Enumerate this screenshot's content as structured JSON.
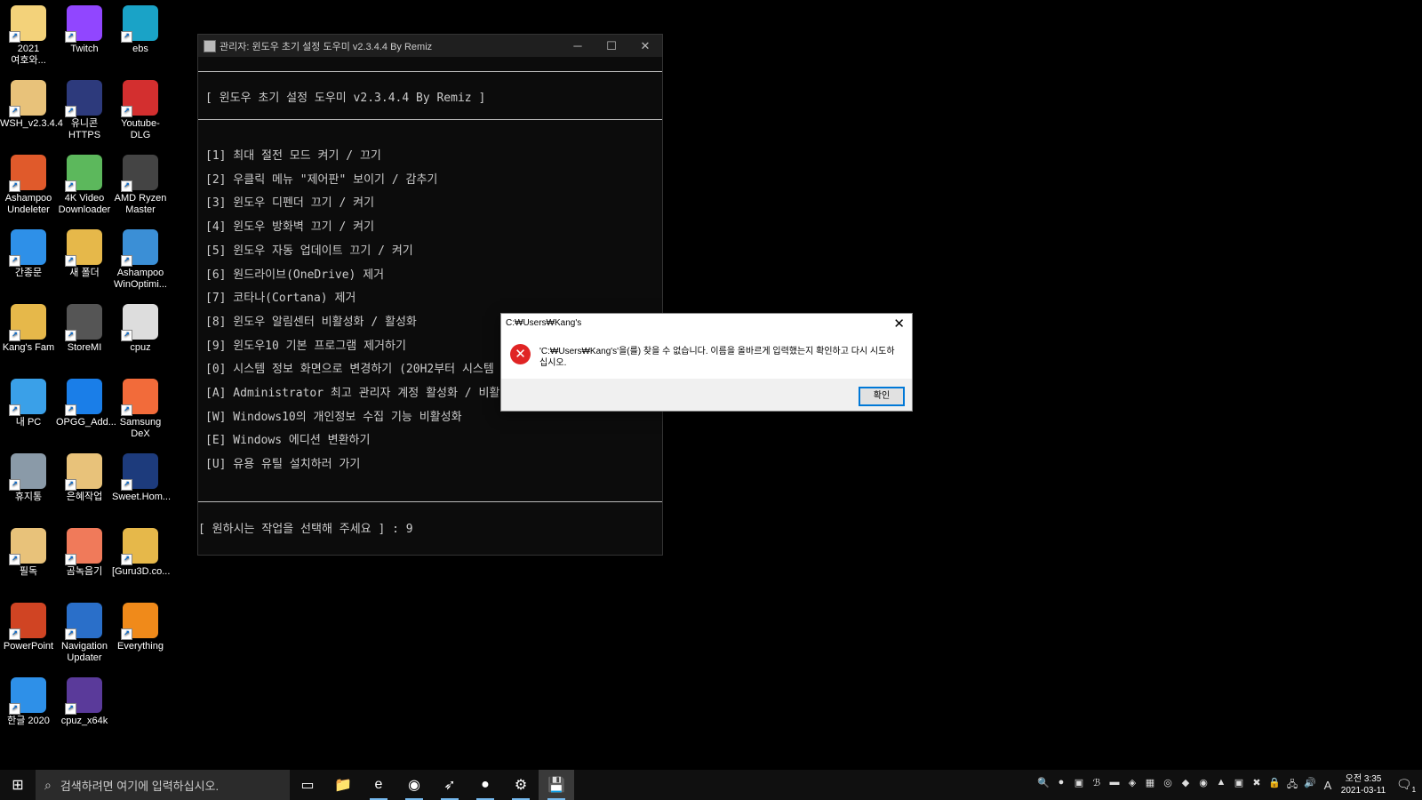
{
  "desktop": {
    "icons": [
      {
        "label": "2021\n여호와...",
        "icon": "folder-icon",
        "color": "#f3d27a"
      },
      {
        "label": "Twitch",
        "icon": "twitch-icon",
        "color": "#9146ff"
      },
      {
        "label": "ebs",
        "icon": "ebs-icon",
        "color": "#1aa3c7"
      },
      {
        "label": "WSH_v2.3.4.4",
        "icon": "archive-icon",
        "color": "#e8c27a"
      },
      {
        "label": "유니콘\nHTTPS",
        "icon": "unicorn-icon",
        "color": "#2d3a7c"
      },
      {
        "label": "Youtube-DLG",
        "icon": "download-icon",
        "color": "#d32f2f"
      },
      {
        "label": "Ashampoo\nUndeleter",
        "icon": "undeleter-icon",
        "color": "#e05a2b"
      },
      {
        "label": "4K Video\nDownloader",
        "icon": "cloud-download-icon",
        "color": "#5cb85c"
      },
      {
        "label": "AMD Ryzen\nMaster",
        "icon": "ryzen-icon",
        "color": "#444444"
      },
      {
        "label": "간종문",
        "icon": "hangul-doc-icon",
        "color": "#2e90e8"
      },
      {
        "label": "새 폴더",
        "icon": "folder-icon",
        "color": "#e6b84a"
      },
      {
        "label": "Ashampoo\nWinOptimi...",
        "icon": "winoptimizer-icon",
        "color": "#3b8fd6"
      },
      {
        "label": "Kang's Fam",
        "icon": "user-folder-icon",
        "color": "#e6b84a"
      },
      {
        "label": "StoreMI",
        "icon": "storemi-icon",
        "color": "#555555"
      },
      {
        "label": "cpuz",
        "icon": "file-gear-icon",
        "color": "#dddddd"
      },
      {
        "label": "내 PC",
        "icon": "pc-icon",
        "color": "#3aa0e8"
      },
      {
        "label": "OPGG_Add...",
        "icon": "opgg-icon",
        "color": "#1a7ee8"
      },
      {
        "label": "Samsung\nDeX",
        "icon": "dex-icon",
        "color": "#f26b3a"
      },
      {
        "label": "휴지통",
        "icon": "recycle-bin-icon",
        "color": "#8a9aa8"
      },
      {
        "label": "은혜작업",
        "icon": "archive-icon",
        "color": "#e8c27a"
      },
      {
        "label": "Sweet.Hom...",
        "icon": "book-icon",
        "color": "#1d3b7c"
      },
      {
        "label": "필독",
        "icon": "archive-icon",
        "color": "#e8c27a"
      },
      {
        "label": "곰녹음기",
        "icon": "mic-icon",
        "color": "#f07a5a"
      },
      {
        "label": "[Guru3D.co...",
        "icon": "folder-icon",
        "color": "#e6b84a"
      },
      {
        "label": "PowerPoint",
        "icon": "powerpoint-icon",
        "color": "#d04423"
      },
      {
        "label": "Navigation\nUpdater",
        "icon": "navigation-icon",
        "color": "#2a6fc9"
      },
      {
        "label": "Everything",
        "icon": "magnifier-icon",
        "color": "#f08a1a"
      },
      {
        "label": "한글 2020",
        "icon": "hangul-icon",
        "color": "#2e90e8"
      },
      {
        "label": "cpuz_x64k",
        "icon": "chip-icon",
        "color": "#5a3a9a"
      }
    ]
  },
  "console": {
    "title": "관리자:  윈도우 초기 설정 도우미 v2.3.4.4 By Remiz",
    "header": "[ 윈도우 초기 설정 도우미 v2.3.4.4 By Remiz ]",
    "menu": [
      "[1] 최대 절전 모드 켜기 / 끄기",
      "[2] 우클릭 메뉴 \"제어판\" 보이기 / 감추기",
      "[3] 윈도우 디펜더 끄기 / 켜기",
      "[4] 윈도우 방화벽 끄기 / 켜기",
      "[5] 윈도우 자동 업데이트 끄기 / 켜기",
      "[6] 원드라이브(OneDrive) 제거",
      "[7] 코타나(Cortana) 제거",
      "[8] 윈도우 알림센터 비활성화 / 활성화",
      "[9] 윈도우10 기본 프로그램 제거하기",
      "[0] 시스템 정보 화면으로 변경하기 (20H2부터 시스템",
      "[A] Administrator 최고 관리자 계정 활성화 / 비활성",
      "[W] Windows10의 개인정보 수집 기능 비활성화",
      "[E] Windows 에디션 변환하기",
      "[U] 유용 유틸 설치하러 가기"
    ],
    "prompt": "[ 원하시는 작업을 선택해 주세요 ] : 9"
  },
  "dialog": {
    "title": "C:₩Users₩Kang's",
    "message": "'C:₩Users₩Kang's'을(를) 찾을 수 없습니다. 이름을 올바르게 입력했는지 확인하고 다시 시도하십시오.",
    "ok_label": "확인"
  },
  "taskbar": {
    "search_placeholder": "검색하려면 여기에 입력하십시오.",
    "apps": [
      {
        "name": "task-view-icon",
        "glyph": "▭"
      },
      {
        "name": "file-explorer-icon",
        "glyph": "📁"
      },
      {
        "name": "edge-icon",
        "glyph": "e"
      },
      {
        "name": "chrome-icon",
        "glyph": "◉"
      },
      {
        "name": "bird-app-icon",
        "glyph": "➶"
      },
      {
        "name": "kakaotalk-icon",
        "glyph": "●"
      },
      {
        "name": "settings-icon",
        "glyph": "⚙"
      },
      {
        "name": "console-app-icon",
        "glyph": "💾"
      }
    ],
    "tray_icons": [
      "🔍",
      "●",
      "▣",
      "ℬ",
      "▬",
      "◈",
      "▦",
      "◎",
      "◆",
      "◉",
      "▲",
      "▣",
      "✖",
      "🔒",
      "🖧",
      "🔊"
    ],
    "ime": "A",
    "clock_time": "오전 3:35",
    "clock_date": "2021-03-11",
    "notification_count": "1"
  }
}
